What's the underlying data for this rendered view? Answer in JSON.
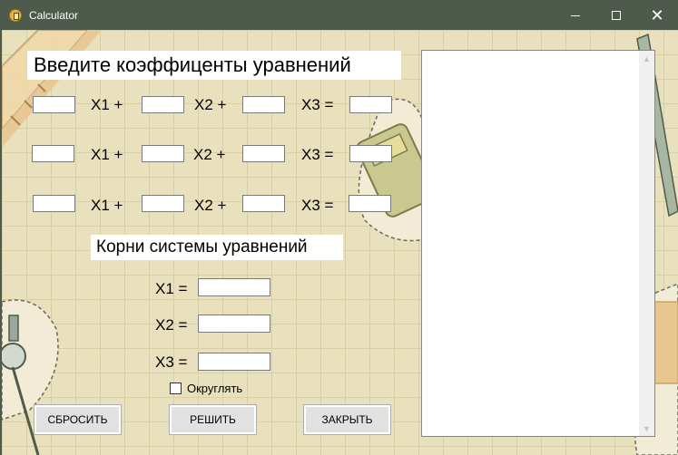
{
  "window": {
    "title": "Calculator",
    "minimize_glyph": "",
    "maximize_glyph": "",
    "close_glyph": "✕"
  },
  "labels": {
    "coefficients_heading": "Введите коэффиценты уравнений",
    "roots_heading": "Корни системы уравнений",
    "x1_plus": "X1 +",
    "x2_plus": "X2 +",
    "x3_equals": "X3 =",
    "x1_equals": "X1 =",
    "x2_equals": "X2 =",
    "x3_result": "X3 ="
  },
  "equations": [
    {
      "a": "",
      "b": "",
      "c": "",
      "d": ""
    },
    {
      "a": "",
      "b": "",
      "c": "",
      "d": ""
    },
    {
      "a": "",
      "b": "",
      "c": "",
      "d": ""
    }
  ],
  "roots": {
    "x1": "",
    "x2": "",
    "x3": ""
  },
  "round_option": {
    "label": "Округлять",
    "checked": false
  },
  "buttons": {
    "reset": "СБРОСИТЬ",
    "solve": "РЕШИТЬ",
    "close": "ЗАКРЫТЬ"
  },
  "output_text": "",
  "icons": {
    "app": "calculator-icon",
    "minimize": "minimize-icon",
    "maximize": "maximize-icon",
    "close": "close-icon",
    "scroll_up": "chevron-up-icon",
    "scroll_down": "chevron-down-icon"
  },
  "colors": {
    "titlebar": "#4e5b4c",
    "background": "#e9e0bd",
    "grid": "#d9cfa5",
    "button": "#e1e1e1"
  }
}
